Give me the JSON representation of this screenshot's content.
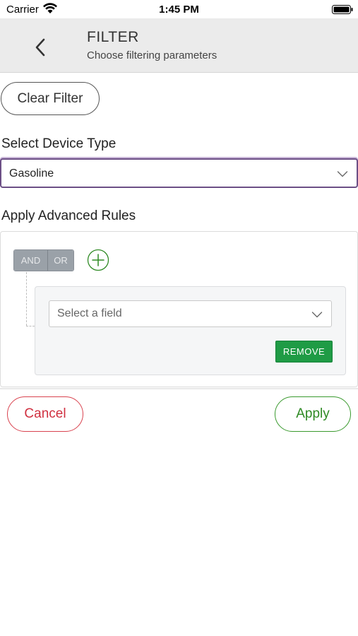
{
  "status_bar": {
    "carrier": "Carrier",
    "time": "1:45 PM",
    "wifi_icon": "wifi-icon",
    "battery_icon": "battery-icon"
  },
  "header": {
    "title": "FILTER",
    "subtitle": "Choose filtering parameters",
    "back_icon": "chevron-left-icon"
  },
  "clear_filter_label": "Clear Filter",
  "device_type": {
    "label": "Select Device Type",
    "selected": "Gasoline",
    "accent_color": "#6c4f86"
  },
  "advanced_rules": {
    "label": "Apply Advanced Rules",
    "and_label": "AND",
    "or_label": "OR",
    "add_icon": "plus-circle-icon",
    "rule": {
      "field_placeholder": "Select a field",
      "remove_label": "REMOVE"
    }
  },
  "actions": {
    "cancel_label": "Cancel",
    "apply_label": "Apply",
    "cancel_color": "#d03040",
    "apply_color": "#2f8a24",
    "remove_color": "#1f9b45"
  }
}
